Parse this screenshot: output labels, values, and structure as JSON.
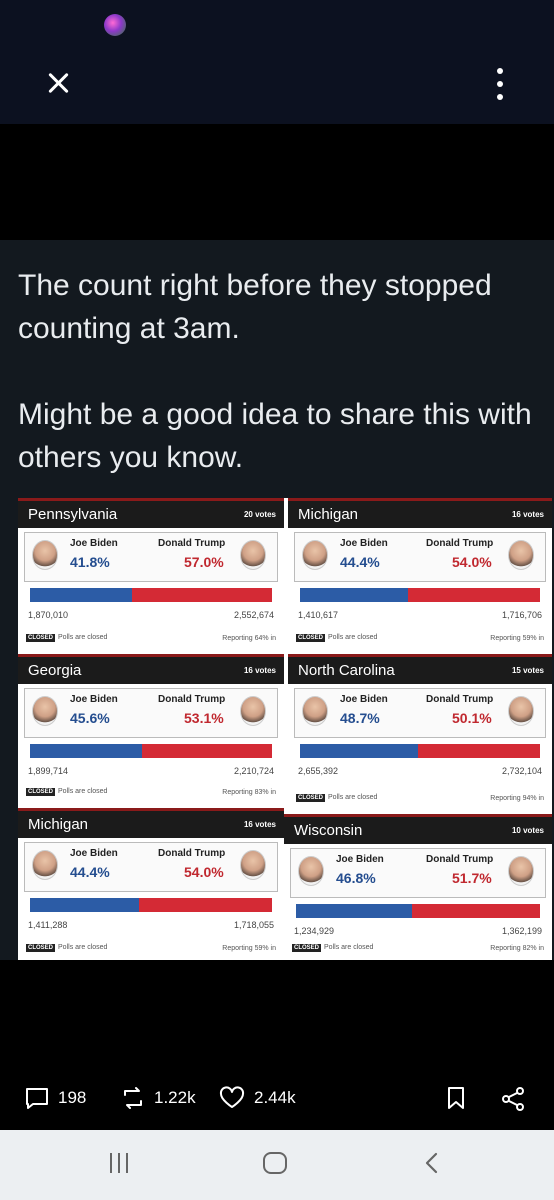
{
  "status_bar": {
    "time": "",
    "right": ""
  },
  "post": {
    "caption": [
      "The count right before they stopped counting at 3am.",
      "Might be a good idea to share this with others you know."
    ]
  },
  "cards": [
    {
      "state": "Pennsylvania",
      "electoral": "20 votes",
      "biden_name": "Joe Biden",
      "trump_name": "Donald Trump",
      "biden_pct": "41.8%",
      "trump_pct": "57.0%",
      "biden_share": 0.418,
      "trump_share": 0.57,
      "biden_votes": "1,870,010",
      "trump_votes": "2,552,674",
      "closed_label": "CLOSED",
      "polls_text": "Polls are closed",
      "reporting": "Reporting 64% in"
    },
    {
      "state": "Michigan",
      "electoral": "16 votes",
      "biden_name": "Joe Biden",
      "trump_name": "Donald Trump",
      "biden_pct": "44.4%",
      "trump_pct": "54.0%",
      "biden_share": 0.444,
      "trump_share": 0.54,
      "biden_votes": "1,410,617",
      "trump_votes": "1,716,706",
      "closed_label": "CLOSED",
      "polls_text": "Polls are closed",
      "reporting": "Reporting 59% in"
    },
    {
      "state": "Georgia",
      "electoral": "16 votes",
      "biden_name": "Joe Biden",
      "trump_name": "Donald Trump",
      "biden_pct": "45.6%",
      "trump_pct": "53.1%",
      "biden_share": 0.456,
      "trump_share": 0.531,
      "biden_votes": "1,899,714",
      "trump_votes": "2,210,724",
      "closed_label": "CLOSED",
      "polls_text": "Polls are closed",
      "reporting": "Reporting 83% in"
    },
    {
      "state": "North Carolina",
      "electoral": "15 votes",
      "biden_name": "Joe Biden",
      "trump_name": "Donald Trump",
      "biden_pct": "48.7%",
      "trump_pct": "50.1%",
      "biden_share": 0.487,
      "trump_share": 0.501,
      "biden_votes": "2,655,392",
      "trump_votes": "2,732,104",
      "closed_label": "CLOSED",
      "polls_text": "Polls are closed",
      "reporting": "Reporting 94% in"
    },
    {
      "state": "Michigan",
      "electoral": "16 votes",
      "biden_name": "Joe Biden",
      "trump_name": "Donald Trump",
      "biden_pct": "44.4%",
      "trump_pct": "54.0%",
      "biden_share": 0.444,
      "trump_share": 0.54,
      "biden_votes": "1,411,288",
      "trump_votes": "1,718,055",
      "closed_label": "CLOSED",
      "polls_text": "Polls are closed",
      "reporting": "Reporting 59% in"
    },
    {
      "state": "Wisconsin",
      "electoral": "10 votes",
      "biden_name": "Joe Biden",
      "trump_name": "Donald Trump",
      "biden_pct": "46.8%",
      "trump_pct": "51.7%",
      "biden_share": 0.468,
      "trump_share": 0.517,
      "biden_votes": "1,234,929",
      "trump_votes": "1,362,199",
      "closed_label": "CLOSED",
      "polls_text": "Polls are closed",
      "reporting": "Reporting 82% in"
    }
  ],
  "actions": {
    "comments": "198",
    "reposts": "1.22k",
    "likes": "2.44k"
  },
  "colors": {
    "biden_blue": "#2c5ca6",
    "trump_red": "#d42a35",
    "header_dark": "#1b1b1b",
    "post_bg": "#13191f"
  }
}
